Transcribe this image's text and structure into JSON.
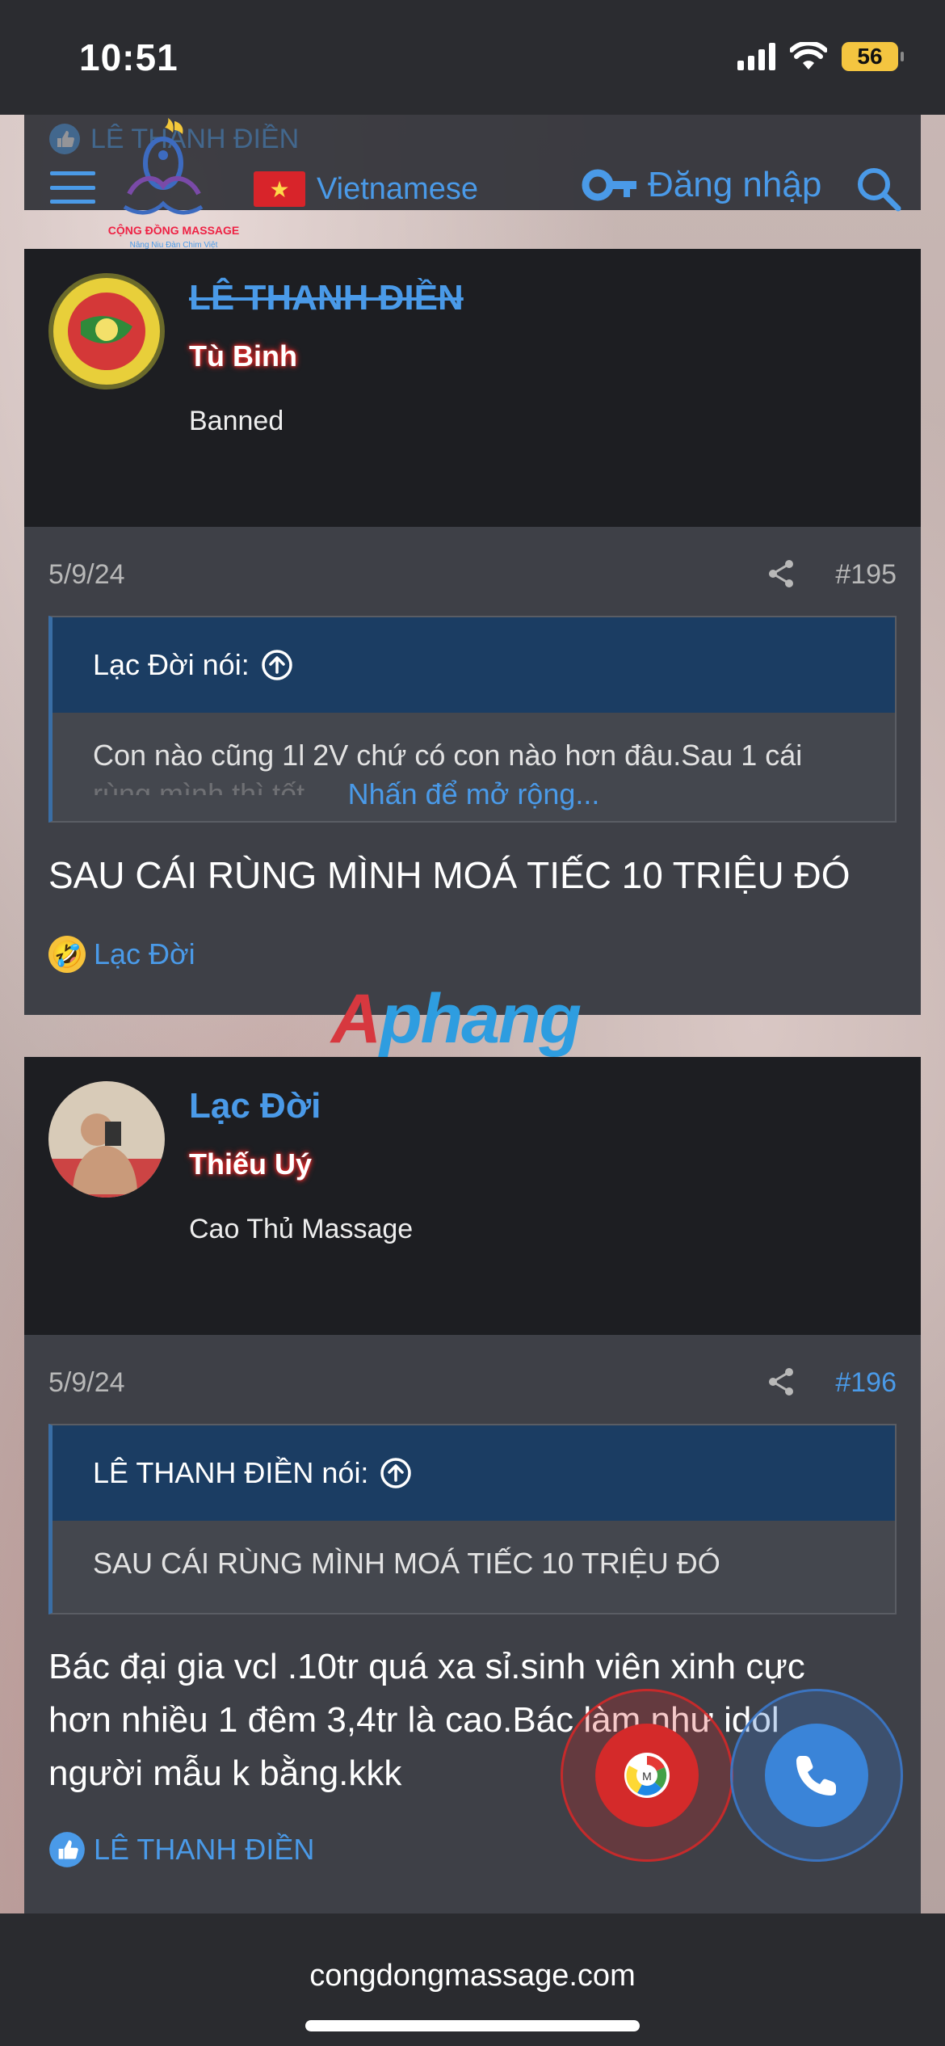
{
  "status": {
    "time": "10:51",
    "battery": "56"
  },
  "header": {
    "ghost_user": "LÊ THANH ĐIỀN",
    "logo_text": "CỘNG ĐỒNG MASSAGE",
    "logo_tagline": "Nâng Niu Đàn Chim Việt",
    "language": "Vietnamese",
    "login": "Đăng nhập"
  },
  "posts": [
    {
      "username": "LÊ THANH ĐIỀN",
      "rank": "Tù Binh",
      "user_title": "Banned",
      "date": "5/9/24",
      "number": "#195",
      "quote_author": "Lạc Đời nói:",
      "quote_text": "Con nào cũng 1l 2V chứ có con nào hơn đâu.Sau 1 cái",
      "quote_text_faded": "rùng mình thì tốt",
      "expand": "Nhấn để mở rộng...",
      "message": "SAU CÁI RÙNG MÌNH MOÁ TIẾC 10 TRIỆU ĐÓ",
      "reaction_user": "Lạc Đời"
    },
    {
      "username": "Lạc Đời",
      "rank": "Thiếu Uý",
      "user_title": "Cao Thủ Massage",
      "date": "5/9/24",
      "number": "#196",
      "quote_author": "LÊ THANH ĐIỀN nói:",
      "quote_text": "SAU CÁI RÙNG MÌNH MOÁ TIẾC 10 TRIỆU ĐÓ",
      "message_lines": [
        "Bác đại gia vcl .10tr quá xa sỉ.sinh viên xinh cực",
        "hơn nhiều 1 đêm 3,4tr là cao.Bác làm như idol",
        "người mẫu k bằng.kkk"
      ],
      "reaction_user": "LÊ THANH ĐIỀN"
    }
  ],
  "watermark": {
    "part1": "A",
    "part2": "phang"
  },
  "bottom": {
    "domain": "congdongmassage.com"
  },
  "colors": {
    "link": "#4a9ae8",
    "quote_header": "#1b3d63",
    "rank_glow": "#ff2a2a"
  },
  "icons": [
    "hamburger-icon",
    "key-icon",
    "search-icon",
    "share-icon",
    "arrow-up-circle-icon",
    "like-icon",
    "laugh-emoji-icon",
    "phone-icon",
    "messenger-icon"
  ]
}
